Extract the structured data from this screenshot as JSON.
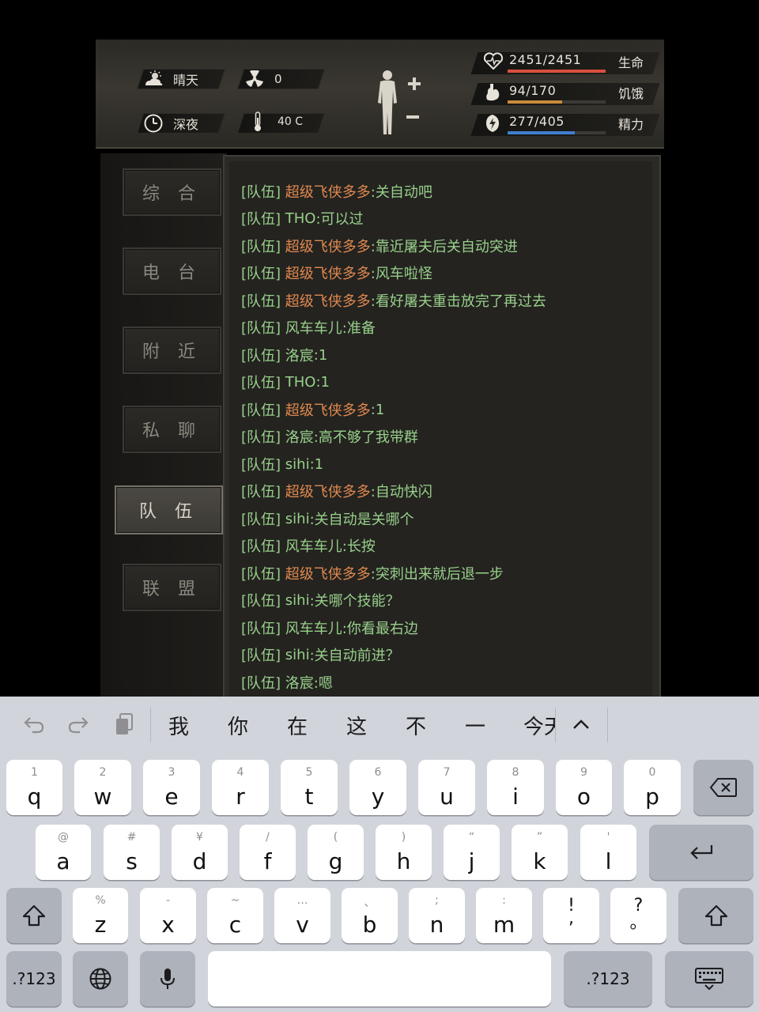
{
  "status": {
    "weather": "晴天",
    "radiation": "0",
    "time_of_day": "深夜",
    "temperature": "40 C",
    "stats": [
      {
        "name": "生命",
        "value_text": "2451/2451",
        "fill": 1.0,
        "color": "#d9503f",
        "icon": "heart-icon"
      },
      {
        "name": "饥饿",
        "value_text": "94/170",
        "fill": 0.553,
        "color": "#c98c3a",
        "icon": "stomach-icon"
      },
      {
        "name": "精力",
        "value_text": "277/405",
        "fill": 0.684,
        "color": "#3f7fcf",
        "icon": "energy-icon"
      }
    ]
  },
  "tabs": [
    {
      "label": "综 合",
      "active": false
    },
    {
      "label": "电 台",
      "active": false
    },
    {
      "label": "附 近",
      "active": false
    },
    {
      "label": "私 聊",
      "active": false
    },
    {
      "label": "队 伍",
      "active": true
    },
    {
      "label": "联 盟",
      "active": false
    }
  ],
  "chat": {
    "channel": "[队伍]",
    "messages": [
      {
        "name": "超级飞侠多多",
        "text": ":关自动吧",
        "highlight": true
      },
      {
        "name": "THO",
        "text": ":可以过",
        "highlight": false
      },
      {
        "name": "超级飞侠多多",
        "text": ":靠近屠夫后关自动突进",
        "highlight": true
      },
      {
        "name": "超级飞侠多多",
        "text": ":风车啦怪",
        "highlight": true
      },
      {
        "name": "超级飞侠多多",
        "text": ":看好屠夫重击放完了再过去",
        "highlight": true
      },
      {
        "name": "风车车儿",
        "text": ":准备",
        "highlight": false
      },
      {
        "name": "洛宸",
        "text": ":1",
        "highlight": false
      },
      {
        "name": "THO",
        "text": ":1",
        "highlight": false
      },
      {
        "name": "超级飞侠多多",
        "text": ":1",
        "highlight": true
      },
      {
        "name": "洛宸",
        "text": ":高不够了我带群",
        "highlight": false
      },
      {
        "name": "sihi",
        "text": ":1",
        "highlight": false
      },
      {
        "name": "超级飞侠多多",
        "text": ":自动快闪",
        "highlight": true
      },
      {
        "name": "sihi",
        "text": ":关自动是关哪个",
        "highlight": false
      },
      {
        "name": "风车车儿",
        "text": ":长按",
        "highlight": false
      },
      {
        "name": "超级飞侠多多",
        "text": ":突刺出来就后退一步",
        "highlight": true
      },
      {
        "name": "sihi",
        "text": ":关哪个技能？",
        "highlight": false
      },
      {
        "name": "风车车儿",
        "text": ":你看最右边",
        "highlight": false
      },
      {
        "name": "sihi",
        "text": ":关自动前进？",
        "highlight": false
      },
      {
        "name": "洛宸",
        "text": ":嗯",
        "highlight": false
      }
    ]
  },
  "keyboard": {
    "candidates": [
      "我",
      "你",
      "在",
      "这",
      "不",
      "一",
      "今天"
    ],
    "row1": [
      {
        "num": "1",
        "key": "q"
      },
      {
        "num": "2",
        "key": "w"
      },
      {
        "num": "3",
        "key": "e"
      },
      {
        "num": "4",
        "key": "r"
      },
      {
        "num": "5",
        "key": "t"
      },
      {
        "num": "6",
        "key": "y"
      },
      {
        "num": "7",
        "key": "u"
      },
      {
        "num": "8",
        "key": "i"
      },
      {
        "num": "9",
        "key": "o"
      },
      {
        "num": "0",
        "key": "p"
      }
    ],
    "row2": [
      {
        "num": "@",
        "key": "a"
      },
      {
        "num": "#",
        "key": "s"
      },
      {
        "num": "¥",
        "key": "d"
      },
      {
        "num": "/",
        "key": "f"
      },
      {
        "num": "(",
        "key": "g"
      },
      {
        "num": ")",
        "key": "h"
      },
      {
        "num": "“",
        "key": "j"
      },
      {
        "num": "”",
        "key": "k"
      },
      {
        "num": "'",
        "key": "l"
      }
    ],
    "row3": [
      {
        "num": "%",
        "key": "z"
      },
      {
        "num": "-",
        "key": "x"
      },
      {
        "num": "~",
        "key": "c"
      },
      {
        "num": "…",
        "key": "v"
      },
      {
        "num": "、",
        "key": "b"
      },
      {
        "num": ";",
        "key": "n"
      },
      {
        "num": ":",
        "key": "m"
      },
      {
        "num": "!",
        "key": ","
      },
      {
        "num": "?",
        "key": "。"
      }
    ],
    "mode_left": ".?123",
    "mode_right": ".?123"
  }
}
